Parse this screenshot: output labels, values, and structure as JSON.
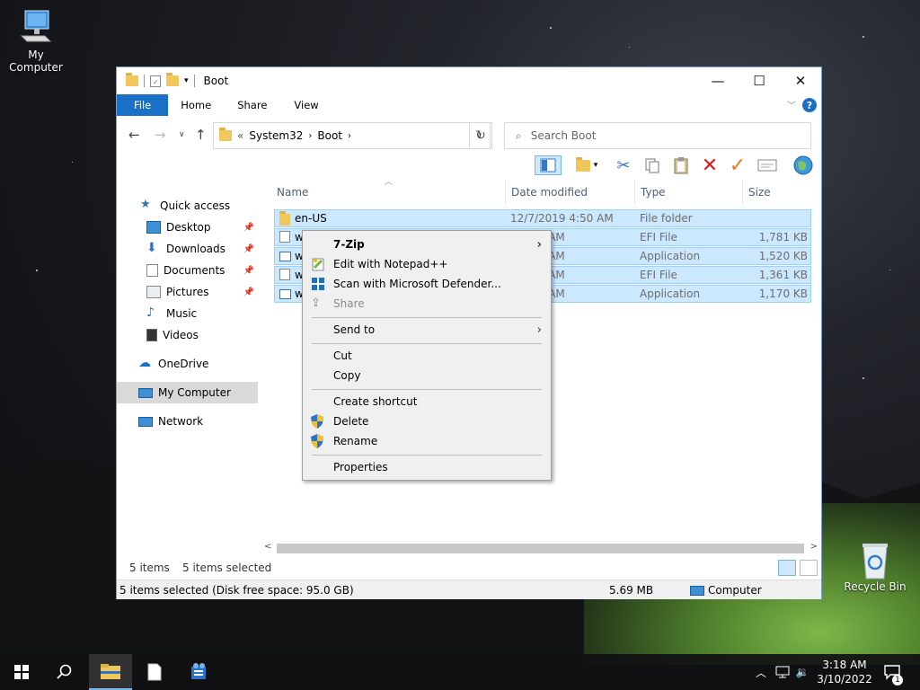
{
  "desktop": {
    "icons": [
      {
        "label": "My Computer"
      },
      {
        "label": "Recycle Bin"
      }
    ]
  },
  "window": {
    "title": "Boot",
    "controls": {
      "minimize": "—",
      "maximize": "☐",
      "close": "✕"
    },
    "ribbon_tabs": [
      "File",
      "Home",
      "Share",
      "View"
    ],
    "help": "?",
    "address": {
      "prefix": "«",
      "crumbs": [
        "System32",
        "Boot"
      ]
    },
    "search_placeholder": "Search Boot"
  },
  "nav": {
    "items": [
      {
        "label": "Quick access",
        "icon": "star-icon"
      },
      {
        "label": "Desktop",
        "icon": "desktop-icon",
        "pinned": true
      },
      {
        "label": "Downloads",
        "icon": "download-icon",
        "pinned": true
      },
      {
        "label": "Documents",
        "icon": "documents-icon",
        "pinned": true
      },
      {
        "label": "Pictures",
        "icon": "pictures-icon",
        "pinned": true
      },
      {
        "label": "Music",
        "icon": "music-icon"
      },
      {
        "label": "Videos",
        "icon": "videos-icon"
      },
      {
        "label": "OneDrive",
        "icon": "cloud-icon"
      },
      {
        "label": "My Computer",
        "icon": "computer-icon",
        "selected": true
      },
      {
        "label": "Network",
        "icon": "network-icon"
      }
    ]
  },
  "files": {
    "columns": [
      "Name",
      "Date modified",
      "Type",
      "Size"
    ],
    "rows": [
      {
        "name": "en-US",
        "date": "12/7/2019 4:50 AM",
        "type": "File folder",
        "size": "",
        "icon": "folder-icon"
      },
      {
        "name": "w",
        "date": "1 9:51 AM",
        "type": "EFI File",
        "size": "1,781 KB",
        "icon": "file-icon"
      },
      {
        "name": "w",
        "date": "1 9:51 AM",
        "type": "Application",
        "size": "1,520 KB",
        "icon": "app-icon"
      },
      {
        "name": "w",
        "date": "1 9:51 AM",
        "type": "EFI File",
        "size": "1,361 KB",
        "icon": "file-icon"
      },
      {
        "name": "w",
        "date": "1 9:51 AM",
        "type": "Application",
        "size": "1,170 KB",
        "icon": "app-icon"
      }
    ]
  },
  "context_menu": {
    "items": [
      {
        "label": "7-Zip",
        "submenu": true,
        "bold": true
      },
      {
        "label": "Edit with Notepad++",
        "icon": "notepadpp-icon"
      },
      {
        "label": "Scan with Microsoft Defender...",
        "icon": "defender-icon"
      },
      {
        "label": "Share",
        "icon": "share-icon",
        "disabled": true
      },
      {
        "label": "Send to",
        "submenu": true
      },
      {
        "label": "Cut"
      },
      {
        "label": "Copy"
      },
      {
        "label": "Create shortcut"
      },
      {
        "label": "Delete",
        "icon": "shield-icon"
      },
      {
        "label": "Rename",
        "icon": "shield-icon"
      },
      {
        "label": "Properties"
      }
    ]
  },
  "status": {
    "items_count": "5 items",
    "selected_count": "5 items selected",
    "detail": "5 items selected (Disk free space: 95.0 GB)",
    "size": "5.69 MB",
    "location": "Computer"
  },
  "taskbar": {
    "time": "3:18 AM",
    "date": "3/10/2022",
    "notifications": "1"
  },
  "colors": {
    "accent": "#1a6fc7",
    "selection": "#cce8ff",
    "selection_border": "#99d1ff"
  }
}
